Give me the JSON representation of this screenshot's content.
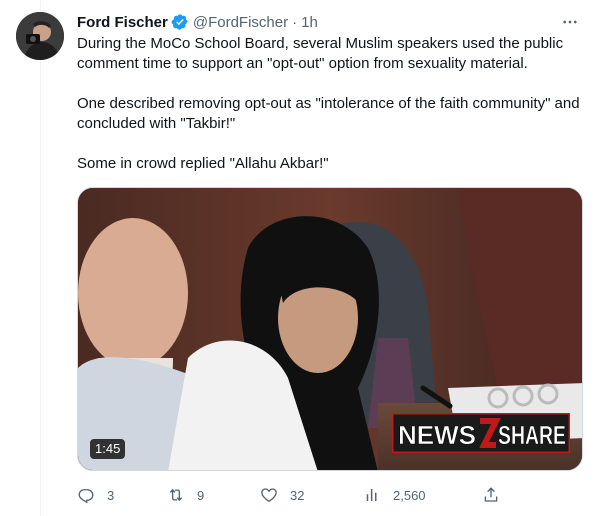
{
  "tweet": {
    "author_name": "Ford Fischer",
    "handle": "@FordFischer",
    "separator": "·",
    "time": "1h",
    "verified": true,
    "paragraphs": [
      "During the MoCo School Board, several Muslim speakers used the public comment time to support an \"opt-out\" option from sexuality material.",
      "One described removing opt-out as \"intolerance of the faith community\" and concluded with \"Takbir!\"",
      "Some in crowd replied \"Allahu Akbar!\""
    ]
  },
  "media": {
    "duration": "1:45",
    "logo_text": "NEWS2SHARE",
    "logo_part_1": "NEWS",
    "logo_part_2": "SHARE"
  },
  "actions": {
    "replies": "3",
    "retweets": "9",
    "likes": "32",
    "views": "2,560"
  },
  "icons": {
    "more": "more-dots-icon",
    "verified": "verified-badge-icon",
    "reply": "reply-icon",
    "retweet": "retweet-icon",
    "like": "heart-icon",
    "views": "views-chart-icon",
    "share": "share-icon"
  },
  "colors": {
    "text_primary": "#0f1419",
    "text_secondary": "#536471",
    "verified": "#1d9bf0",
    "border": "#cfd9de"
  }
}
